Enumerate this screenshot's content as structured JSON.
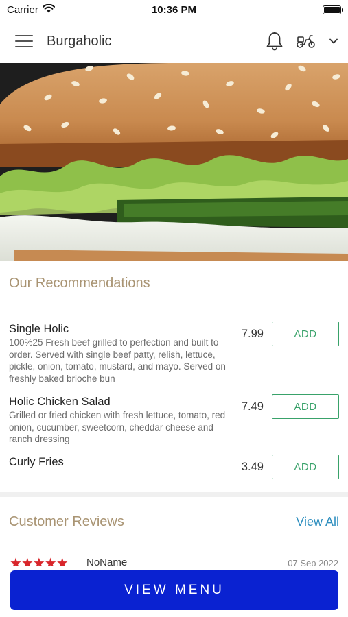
{
  "status": {
    "carrier": "Carrier",
    "time": "10:36 PM"
  },
  "nav": {
    "title": "Burgaholic"
  },
  "recommendations": {
    "title": "Our Recommendations",
    "items": [
      {
        "name": "Single Holic",
        "description": "100%25 Fresh beef grilled to perfection and built to order. Served with single beef patty, relish, lettuce, pickle, onion, tomato, mustard, and mayo. Served on freshly baked brioche bun",
        "price": "7.99",
        "button": "ADD"
      },
      {
        "name": "Holic Chicken Salad",
        "description": "Grilled or fried chicken with fresh lettuce, tomato, red onion, cucumber, sweetcorn, cheddar cheese and ranch dressing",
        "price": "7.49",
        "button": "ADD"
      },
      {
        "name": "Curly Fries",
        "description": "",
        "price": "3.49",
        "button": "ADD"
      }
    ]
  },
  "reviews": {
    "title": "Customer Reviews",
    "view_all": "View All",
    "first": {
      "stars": "★★★★★",
      "rating": 5,
      "name": "NoName",
      "date": "07 Sep 2022"
    }
  },
  "cta": {
    "label": "VIEW MENU"
  },
  "colors": {
    "accent_gold": "#a99473",
    "add_green": "#39a26a",
    "link_blue": "#2f8fbf",
    "cta_blue": "#0a22d1",
    "star_red": "#d8262b"
  }
}
